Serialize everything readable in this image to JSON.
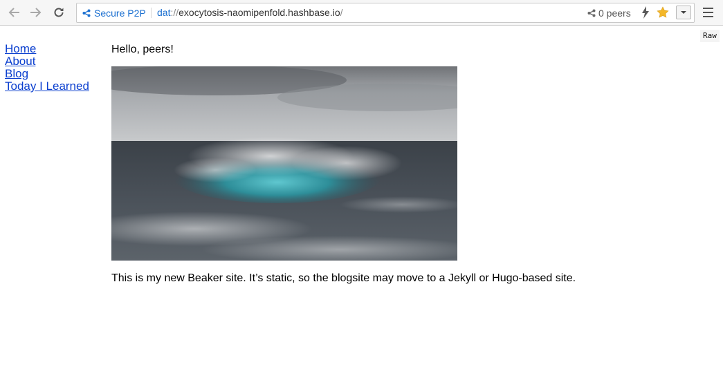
{
  "toolbar": {
    "secure_label": "Secure P2P",
    "url_protocol": "dat",
    "url_separator": "://",
    "url_host": "exocytosis-naomipenfold.hashbase.io",
    "url_path": "/",
    "peers_label": "0 peers"
  },
  "page": {
    "raw_label": "Raw",
    "nav": [
      "Home",
      "About",
      "Blog",
      "Today I Learned"
    ],
    "greeting": "Hello, peers!",
    "paragraph": "This is my new Beaker site. It’s static, so the blogsite may move to a Jekyll or Hugo-based site."
  },
  "icons": {
    "back": "arrow-left-icon",
    "forward": "arrow-right-icon",
    "reload": "reload-icon",
    "secure": "share-icon",
    "peers": "share-icon",
    "bolt": "lightning-icon",
    "star": "star-icon",
    "dropdown": "chevron-down-icon",
    "menu": "hamburger-menu-icon"
  },
  "colors": {
    "link": "#0b3fcf",
    "secure": "#1a6fd0",
    "star": "#f4b728"
  }
}
